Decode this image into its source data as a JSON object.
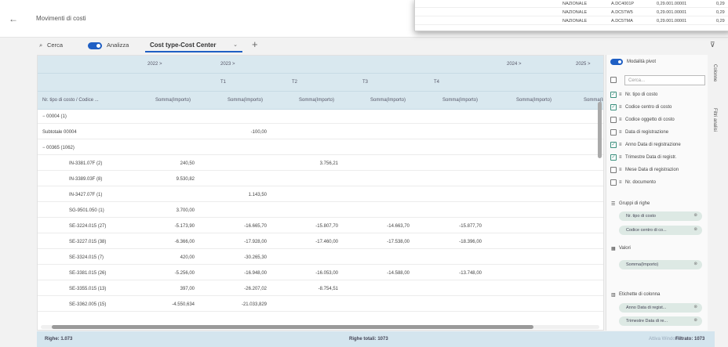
{
  "page": {
    "title": "Movimenti di costi"
  },
  "popup": {
    "rows": [
      [
        "NAZIONALE",
        "A.DC4001P",
        "0,29.001.00001",
        "0,29"
      ],
      [
        "NAZIONALE",
        "A.DC5TW5",
        "0,29.001.00001",
        "0,29"
      ],
      [
        "NAZIONALE",
        "A.DC5TMA",
        "0,29.001.00001",
        "0,29"
      ]
    ]
  },
  "toolbar": {
    "search_label": "Cerca",
    "analyze_label": "Analizza",
    "tab_label": "Cost type-Cost Center",
    "add_label": "+"
  },
  "grid": {
    "years": [
      "2022 >",
      "2023 >",
      "2024 >",
      "2025 >"
    ],
    "quarters": [
      "T1",
      "T2",
      "T3",
      "T4"
    ],
    "col_title": "Nr. tipo di costo / Codice ...",
    "value_header": "Somma(Importo)",
    "rows": [
      {
        "label": "−  00004 (1)",
        "indent": 0,
        "cells": [
          "",
          "",
          "",
          "",
          "",
          "",
          ""
        ]
      },
      {
        "label": "Subtotale 00004",
        "indent": 0,
        "cells": [
          "",
          "-100,00",
          "",
          "",
          "",
          "",
          ""
        ]
      },
      {
        "label": "−  00365 (1062)",
        "indent": 0,
        "cells": [
          "",
          "",
          "",
          "",
          "",
          "",
          ""
        ]
      },
      {
        "label": "IN-3381.07F (2)",
        "indent": 1,
        "cells": [
          "240,50",
          "",
          "3.756,21",
          "",
          "",
          "",
          ""
        ]
      },
      {
        "label": "IN-3389.03F (8)",
        "indent": 1,
        "cells": [
          "9.530,82",
          "",
          "",
          "",
          "",
          "",
          ""
        ]
      },
      {
        "label": "IN-3427.07F (1)",
        "indent": 1,
        "cells": [
          "",
          "1.143,50",
          "",
          "",
          "",
          "",
          ""
        ]
      },
      {
        "label": "SG-9501.050 (1)",
        "indent": 1,
        "cells": [
          "3.700,00",
          "",
          "",
          "",
          "",
          "",
          ""
        ]
      },
      {
        "label": "SE-3224.015 (27)",
        "indent": 1,
        "cells": [
          "-5.173,90",
          "-16.665,70",
          "-15.807,70",
          "-14.663,70",
          "-15.877,70",
          "",
          ""
        ]
      },
      {
        "label": "SE-3227.015 (38)",
        "indent": 1,
        "cells": [
          "-6.366,00",
          "-17.928,00",
          "-17.460,00",
          "-17.538,00",
          "-18.396,00",
          "",
          ""
        ]
      },
      {
        "label": "SE-3324.015 (7)",
        "indent": 1,
        "cells": [
          "420,00",
          "-30.265,30",
          "",
          "",
          "",
          "",
          ""
        ]
      },
      {
        "label": "SE-3381.015 (26)",
        "indent": 1,
        "cells": [
          "-5.256,00",
          "-16.948,00",
          "-16.053,00",
          "-14.588,00",
          "-13.748,00",
          "",
          ""
        ]
      },
      {
        "label": "SE-3355.015 (13)",
        "indent": 1,
        "cells": [
          "397,00",
          "-26.207,02",
          "-8.754,51",
          "",
          "",
          "",
          ""
        ]
      },
      {
        "label": "SE-3362.005 (15)",
        "indent": 1,
        "cells": [
          "-4.550,634",
          "-21.033,829",
          "",
          "",
          "",
          "",
          ""
        ]
      }
    ]
  },
  "panel": {
    "pivot_label": "Modalità pivot",
    "search_placeholder": "Cerca...",
    "fields": [
      {
        "label": "Nr. tipo di costo",
        "checked": "✓"
      },
      {
        "label": "Codice centro di costo",
        "checked": "✓"
      },
      {
        "label": "Codice oggetto di costo",
        "checked": ""
      },
      {
        "label": "Data di registrazione",
        "checked": ""
      },
      {
        "label": "Anno Data di registrazione",
        "checked": "✓"
      },
      {
        "label": "Trimestre Data di registr.",
        "checked": "✓"
      },
      {
        "label": "Mese Data di registrazion",
        "checked": ""
      },
      {
        "label": "Nr. documento",
        "checked": ""
      }
    ],
    "row_groups_label": "Gruppi di righe",
    "row_groups": [
      "Nr. tipo di costo",
      "Codice centro di co..."
    ],
    "values_label": "Valori",
    "values": [
      "Somma(Importo)"
    ],
    "col_labels_label": "Etichette di colonna",
    "col_labels": [
      "Anno Data di regist...",
      "Trimestre Data di re..."
    ],
    "tab_columns": "Colonne",
    "tab_filters": "Filtri analisi"
  },
  "status": {
    "rows": "Righe: 1.073",
    "total": "Righe totali: 1073",
    "filtered": "Filtrato: 1073",
    "watermark": "Attiva Windows"
  },
  "colors": {
    "accent": "#1f5fc4",
    "header_bg": "#d9e8ef",
    "status_bg": "#d4e5ee"
  },
  "icons": [
    "back-arrow-icon",
    "search-icon",
    "chevron-down-icon",
    "plus-icon",
    "filter-icon",
    "checkbox-icon",
    "drag-handle-icon",
    "remove-chip-icon"
  ]
}
